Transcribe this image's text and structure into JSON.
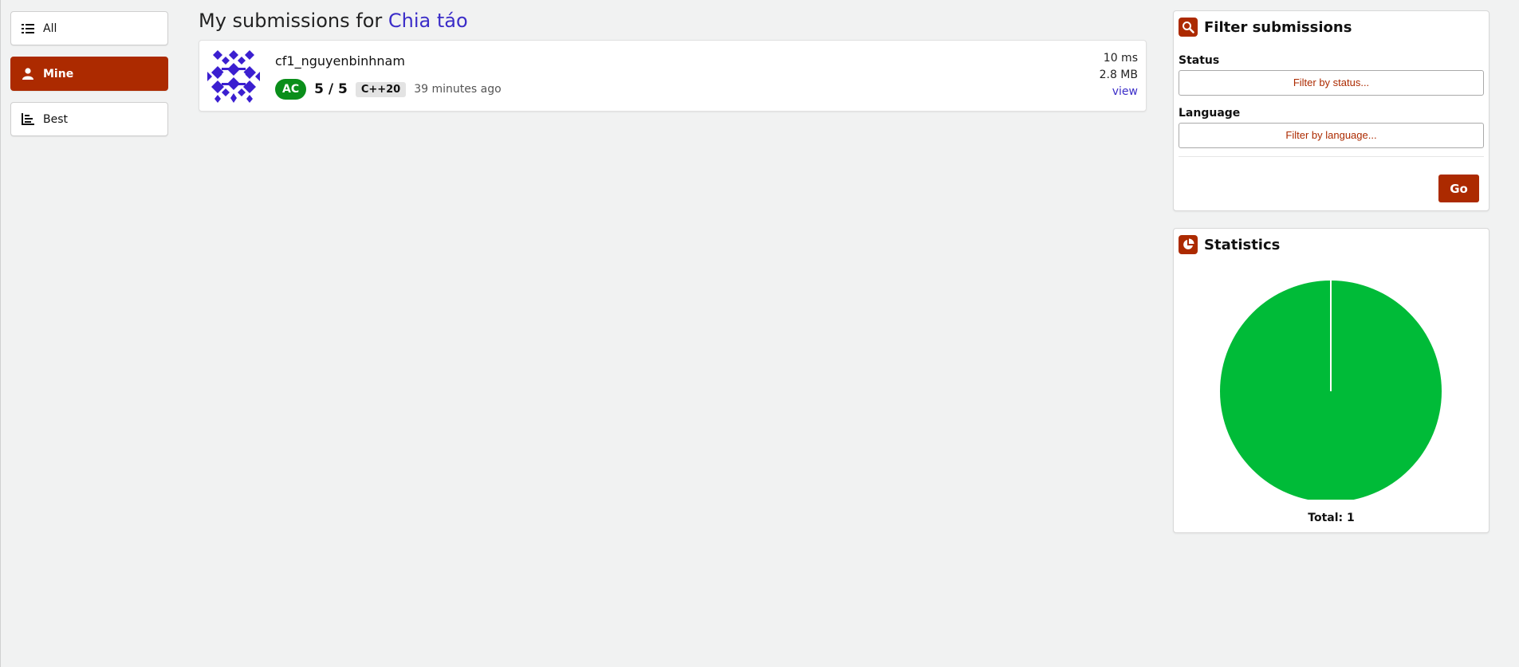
{
  "nav": {
    "items": [
      {
        "label": "All",
        "icon": "list-icon",
        "active": false
      },
      {
        "label": "Mine",
        "icon": "user-icon",
        "active": true
      },
      {
        "label": "Best",
        "icon": "bar-chart-icon",
        "active": false
      }
    ]
  },
  "main": {
    "title_prefix": "My submissions for",
    "problem_name": "Chia táo",
    "submission": {
      "user": "cf1_nguyenbinhnam",
      "status": "AC",
      "score": "5 / 5",
      "language": "C++20",
      "time_ago": "39 minutes ago",
      "runtime": "10 ms",
      "memory": "2.8 MB",
      "view_label": "view"
    }
  },
  "filter": {
    "title": "Filter submissions",
    "status_label": "Status",
    "status_placeholder": "Filter by status...",
    "language_label": "Language",
    "language_placeholder": "Filter by language...",
    "go_label": "Go"
  },
  "stats": {
    "title": "Statistics",
    "total_label": "Total: 1"
  },
  "chart_data": {
    "type": "pie",
    "categories": [
      "AC"
    ],
    "values": [
      1
    ],
    "colors": [
      "#00bb38"
    ]
  },
  "colors": {
    "accent": "#ac2a00",
    "link": "#3b2dc8",
    "ac_badge": "#0a8e1a",
    "pie_ac": "#00bb38"
  }
}
